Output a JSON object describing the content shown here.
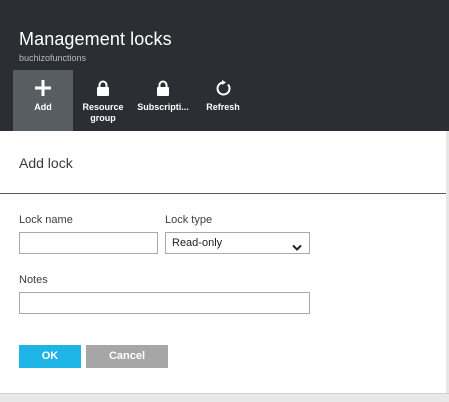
{
  "blade": {
    "title": "Management locks",
    "subtitle": "buchizofunctions"
  },
  "commands": [
    {
      "label": "Add",
      "label2": "",
      "icon": "plus-icon"
    },
    {
      "label": "Resource",
      "label2": "group",
      "icon": "lock-icon"
    },
    {
      "label": "Subscripti...",
      "label2": "",
      "icon": "lock-icon"
    },
    {
      "label": "Refresh",
      "label2": "",
      "icon": "refresh-icon"
    }
  ],
  "form": {
    "title": "Add lock",
    "lock_name_label": "Lock name",
    "lock_name_value": "",
    "lock_type_label": "Lock type",
    "lock_type_value": "Read-only",
    "notes_label": "Notes",
    "notes_value": "",
    "ok_label": "OK",
    "cancel_label": "Cancel"
  },
  "colors": {
    "header_bg": "#2b2f33",
    "active_command_bg": "#585d62",
    "ok_button": "#1fb4e6",
    "cancel_button": "#a6a6a6"
  }
}
